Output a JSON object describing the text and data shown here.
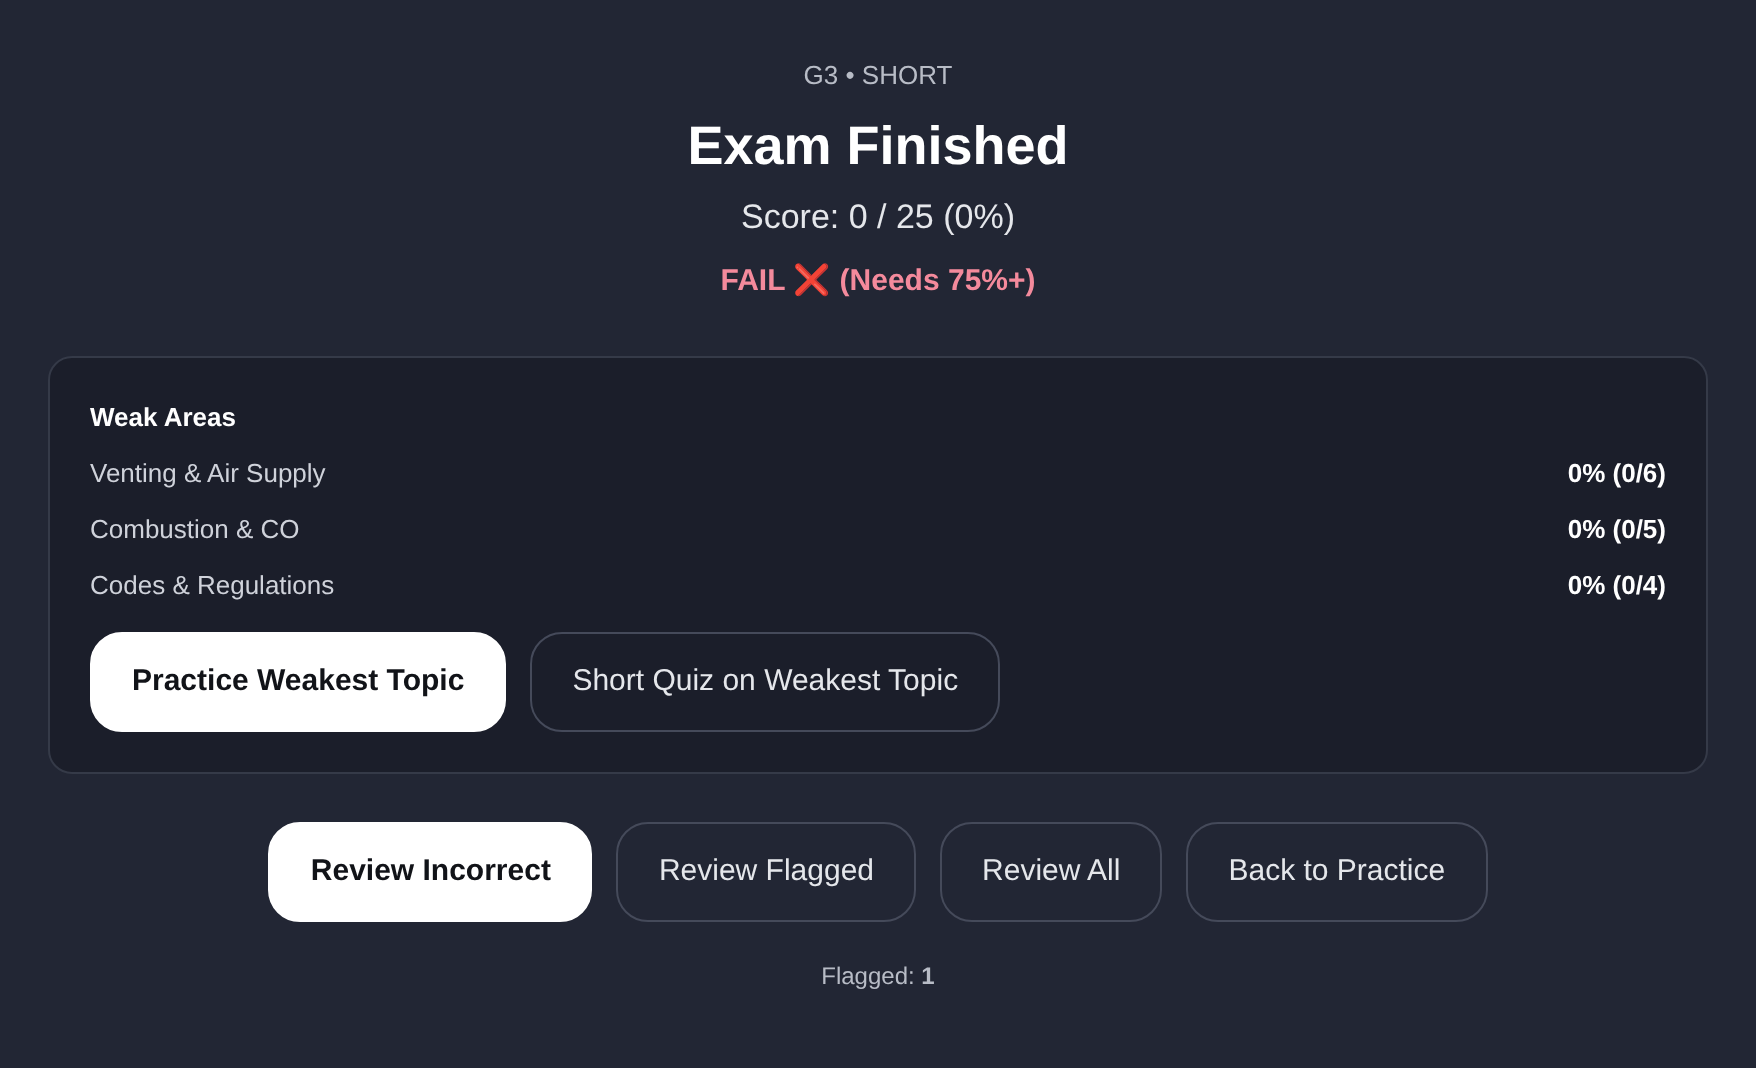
{
  "header": {
    "subtitle": "G3 • SHORT",
    "title": "Exam Finished",
    "score": "Score: 0 / 25 (0%)",
    "result": "FAIL ❌ (Needs 75%+)"
  },
  "weak_areas": {
    "heading": "Weak Areas",
    "rows": [
      {
        "topic": "Venting & Air Supply",
        "value": "0% (0/6)"
      },
      {
        "topic": "Combustion & CO",
        "value": "0% (0/5)"
      },
      {
        "topic": "Codes & Regulations",
        "value": "0% (0/4)"
      }
    ],
    "buttons": [
      {
        "label": "Practice Weakest Topic",
        "kind": "primary"
      },
      {
        "label": "Short Quiz on Weakest Topic",
        "kind": "secondary"
      }
    ]
  },
  "actions": [
    {
      "label": "Review Incorrect",
      "kind": "primary"
    },
    {
      "label": "Review Flagged",
      "kind": "secondary"
    },
    {
      "label": "Review All",
      "kind": "secondary"
    },
    {
      "label": "Back to Practice",
      "kind": "secondary"
    }
  ],
  "footer": "Flagged: **1**"
}
